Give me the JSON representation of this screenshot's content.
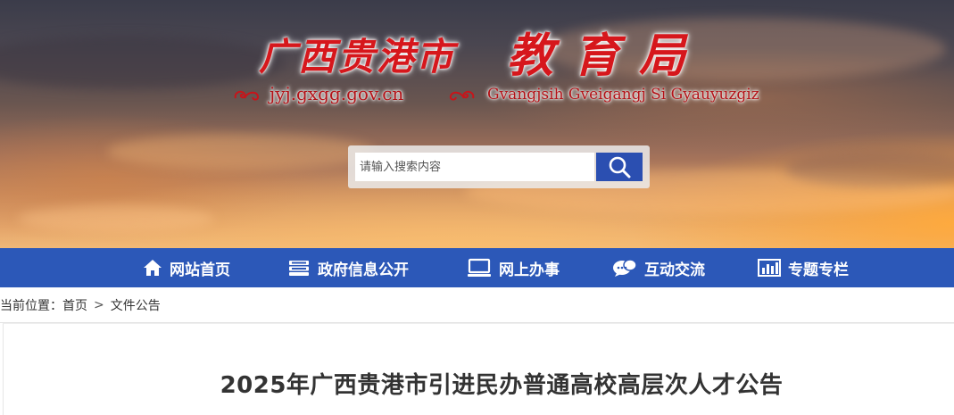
{
  "header": {
    "site_title": "广西贵港市",
    "dept_title": "教育局",
    "domain": "jyj.gxgg.gov.cn",
    "zhuang_name": "Gvangjsih Gveigangj Si Gyauyuzgiz"
  },
  "search": {
    "placeholder": "请输入搜索内容",
    "button_icon": "search-icon"
  },
  "nav": {
    "items": [
      {
        "label": "网站首页",
        "icon": "home-icon"
      },
      {
        "label": "政府信息公开",
        "icon": "document-stack-icon"
      },
      {
        "label": "网上办事",
        "icon": "monitor-icon"
      },
      {
        "label": "互动交流",
        "icon": "chat-bubble-icon"
      },
      {
        "label": "专题专栏",
        "icon": "bar-chart-icon"
      }
    ]
  },
  "breadcrumb": {
    "prefix": "当前位置：",
    "home": "首页",
    "separator": ">",
    "current": "文件公告"
  },
  "article": {
    "title": "2025年广西贵港市引进民办普通高校高层次人才公告"
  },
  "colors": {
    "nav_bg": "#2c58b8",
    "search_button": "#2b4fb1",
    "title_red": "#d6171c"
  }
}
